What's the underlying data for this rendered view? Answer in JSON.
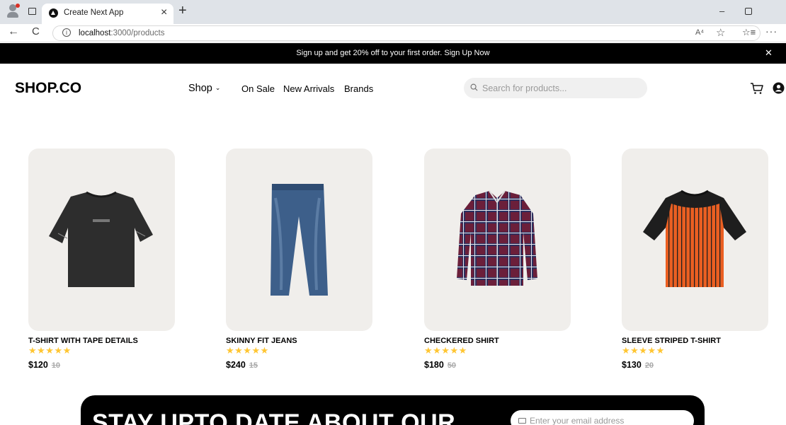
{
  "browser": {
    "tab_title": "Create Next App",
    "tab_close": "×",
    "new_tab": "+",
    "url_host": "localhost",
    "url_path": ":3000/products",
    "back": "←",
    "reload": "C",
    "info": "i",
    "read_aloud": "A⁴",
    "favorite": "☆",
    "favorites": "☆≡",
    "more": "···",
    "minimize": "–"
  },
  "promo": {
    "text": "Sign up and get 20% off to your first order.",
    "link": "Sign Up Now",
    "close": "✕"
  },
  "header": {
    "logo": "SHOP.CO",
    "nav": {
      "shop": "Shop",
      "shop_chevron": "⌄",
      "on_sale": "On Sale",
      "new_arrivals": "New Arrivals",
      "brands": "Brands"
    },
    "search_placeholder": "Search for products..."
  },
  "products": [
    {
      "name": "T-SHIRT WITH TAPE DETAILS",
      "stars": "★★★★★",
      "rating": 5,
      "price": "$120",
      "old_price": "10",
      "icon": "black-tshirt"
    },
    {
      "name": "SKINNY FIT JEANS",
      "stars": "★★★★★",
      "rating": 5,
      "price": "$240",
      "old_price": "15",
      "icon": "blue-jeans"
    },
    {
      "name": "CHECKERED SHIRT",
      "stars": "★★★★★",
      "rating": 5,
      "price": "$180",
      "old_price": "50",
      "icon": "plaid-shirt"
    },
    {
      "name": "SLEEVE STRIPED T-SHIRT",
      "stars": "★★★★★",
      "rating": 5,
      "price": "$130",
      "old_price": "20",
      "icon": "striped-tshirt"
    }
  ],
  "newsletter": {
    "title": "STAY UPTO DATE ABOUT OUR",
    "email_placeholder": "Enter your email address"
  },
  "colors": {
    "promo_bg": "#000000",
    "star": "#FFC633",
    "card_bg": "#F0EEEB",
    "search_bg": "#F0F0F0"
  }
}
